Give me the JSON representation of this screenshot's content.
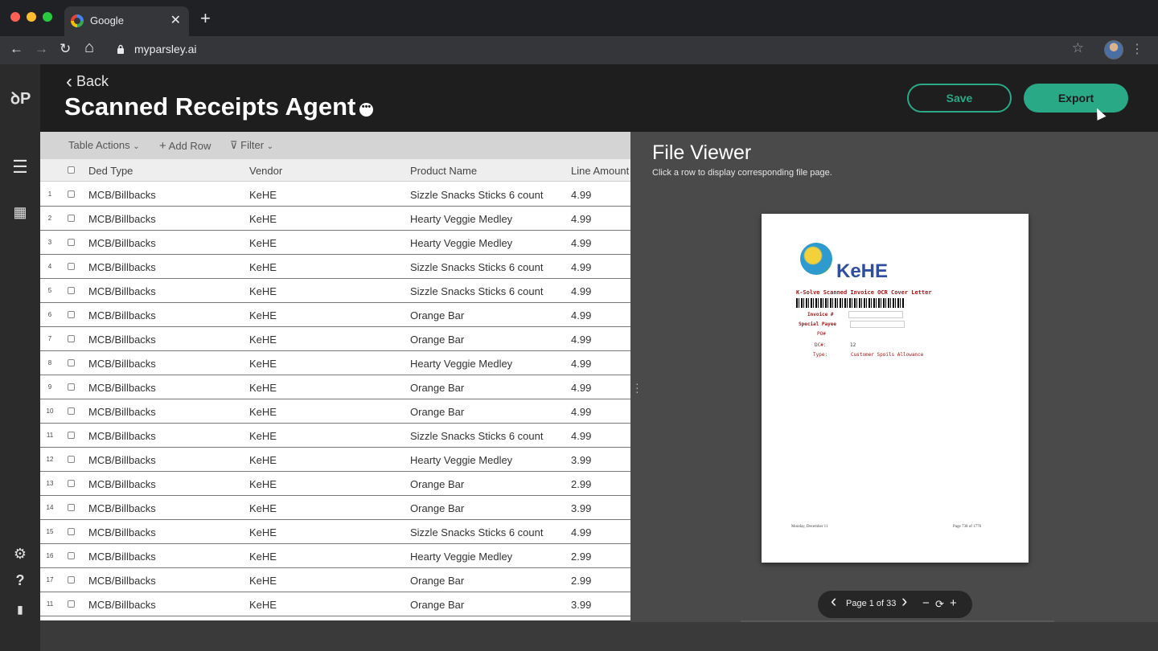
{
  "browser": {
    "tab_title": "Google",
    "tab_close": "✕",
    "new_tab": "+",
    "url": "myparsley.ai",
    "back": "←",
    "forward": "→",
    "reload": "↻",
    "home": "⌂",
    "star": "☆",
    "menu": "⋮"
  },
  "sidebar": {
    "logo": "ꝺP",
    "menu_icon": "☰",
    "grid_icon": "▦",
    "settings_icon": "⚙",
    "help_icon": "?",
    "docs_icon": "▮"
  },
  "header": {
    "back_label": "Back",
    "back_chevron": "‹",
    "title": "Scanned Receipts Agent",
    "more": "•••",
    "save_label": "Save",
    "export_label": "Export"
  },
  "toolbar": {
    "table_actions": "Table Actions",
    "add_row": "Add Row",
    "filter": "Filter"
  },
  "table": {
    "columns": [
      "Ded Type",
      "Vendor",
      "Product Name",
      "Line Amount"
    ],
    "rows": [
      {
        "num": "1",
        "ded": "MCB/Billbacks",
        "vendor": "KeHE",
        "product": "Sizzle Snacks Sticks 6 count",
        "amount": "4.99"
      },
      {
        "num": "2",
        "ded": "MCB/Billbacks",
        "vendor": "KeHE",
        "product": "Hearty Veggie Medley",
        "amount": "4.99"
      },
      {
        "num": "3",
        "ded": "MCB/Billbacks",
        "vendor": "KeHE",
        "product": "Hearty Veggie Medley",
        "amount": "4.99"
      },
      {
        "num": "4",
        "ded": "MCB/Billbacks",
        "vendor": "KeHE",
        "product": "Sizzle Snacks Sticks 6 count",
        "amount": "4.99"
      },
      {
        "num": "5",
        "ded": "MCB/Billbacks",
        "vendor": "KeHE",
        "product": "Sizzle Snacks Sticks 6 count",
        "amount": "4.99"
      },
      {
        "num": "6",
        "ded": "MCB/Billbacks",
        "vendor": "KeHE",
        "product": "Orange Bar",
        "amount": "4.99"
      },
      {
        "num": "7",
        "ded": "MCB/Billbacks",
        "vendor": "KeHE",
        "product": "Orange Bar",
        "amount": "4.99"
      },
      {
        "num": "8",
        "ded": "MCB/Billbacks",
        "vendor": "KeHE",
        "product": "Hearty Veggie Medley",
        "amount": "4.99"
      },
      {
        "num": "9",
        "ded": "MCB/Billbacks",
        "vendor": "KeHE",
        "product": "Orange Bar",
        "amount": "4.99"
      },
      {
        "num": "10",
        "ded": "MCB/Billbacks",
        "vendor": "KeHE",
        "product": "Orange Bar",
        "amount": "4.99"
      },
      {
        "num": "11",
        "ded": "MCB/Billbacks",
        "vendor": "KeHE",
        "product": "Sizzle Snacks Sticks 6 count",
        "amount": "4.99"
      },
      {
        "num": "12",
        "ded": "MCB/Billbacks",
        "vendor": "KeHE",
        "product": "Hearty Veggie Medley",
        "amount": "3.99"
      },
      {
        "num": "13",
        "ded": "MCB/Billbacks",
        "vendor": "KeHE",
        "product": "Orange Bar",
        "amount": "2.99"
      },
      {
        "num": "14",
        "ded": "MCB/Billbacks",
        "vendor": "KeHE",
        "product": "Orange Bar",
        "amount": "3.99"
      },
      {
        "num": "15",
        "ded": "MCB/Billbacks",
        "vendor": "KeHE",
        "product": "Sizzle Snacks Sticks 6 count",
        "amount": "4.99"
      },
      {
        "num": "16",
        "ded": "MCB/Billbacks",
        "vendor": "KeHE",
        "product": "Hearty Veggie Medley",
        "amount": "2.99"
      },
      {
        "num": "17",
        "ded": "MCB/Billbacks",
        "vendor": "KeHE",
        "product": "Orange Bar",
        "amount": "2.99"
      },
      {
        "num": "11",
        "ded": "MCB/Billbacks",
        "vendor": "KeHE",
        "product": "Orange Bar",
        "amount": "3.99"
      }
    ]
  },
  "viewer": {
    "title": "File Viewer",
    "subtitle": "Click a row to display corresponding file page.",
    "close": "×",
    "doc": {
      "brand": "KeHE",
      "heading": "K-Solve Scanned Invoice OCR Cover Letter",
      "invoice_label": "Invoice #",
      "payee_label": "Special Payee",
      "po_label": "PO#",
      "dc_label": "DC#:",
      "dc_value": "12",
      "type_label": "Type:",
      "type_value": "Customer Spoils Allowance",
      "footer_left": "Monday, December 11",
      "footer_right": "Page 738 of 1776"
    },
    "pager": {
      "prev": "‹",
      "next": "›",
      "page_text": "Page 1 of 33",
      "zoom_out": "−",
      "rotate": "⟳",
      "zoom_in": "+"
    }
  },
  "colors": {
    "accent": "#2aa987",
    "header_bg": "#1e1e1e",
    "viewer_bg": "#4a4a4a"
  }
}
